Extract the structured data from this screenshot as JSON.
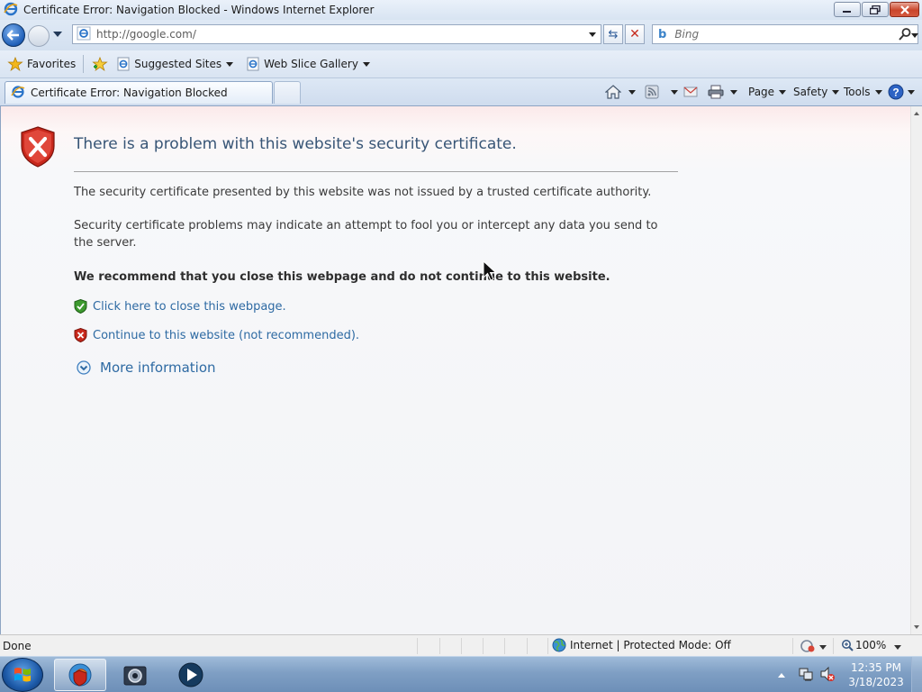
{
  "window": {
    "title": "Certificate Error: Navigation Blocked - Windows Internet Explorer"
  },
  "address_bar": {
    "url": "http://google.com/",
    "search_placeholder": "Bing"
  },
  "favorites_bar": {
    "favorites_label": "Favorites",
    "items": [
      {
        "label": "Suggested Sites"
      },
      {
        "label": "Web Slice Gallery"
      }
    ]
  },
  "tab": {
    "label": "Certificate Error: Navigation Blocked"
  },
  "command_bar": {
    "page_label": "Page",
    "safety_label": "Safety",
    "tools_label": "Tools"
  },
  "error_page": {
    "heading": "There is a problem with this website's security certificate.",
    "paragraph1": "The security certificate presented by this website was not issued by a trusted certificate authority.",
    "paragraph2": "Security certificate problems may indicate an attempt to fool you or intercept any data you send to the server.",
    "recommendation": "We recommend that you close this webpage and do not continue to this website.",
    "close_link": "Click here to close this webpage.",
    "continue_link": "Continue to this website (not recommended).",
    "more_info": "More information"
  },
  "status_bar": {
    "status": "Done",
    "zone": "Internet | Protected Mode: Off",
    "zoom": "100%"
  },
  "taskbar": {
    "time": "12:35 PM",
    "date": "3/18/2023"
  },
  "colors": {
    "link": "#2e6aa3",
    "heading": "#375576",
    "error_red": "#c8281c",
    "safe_green": "#3d9a2f"
  }
}
